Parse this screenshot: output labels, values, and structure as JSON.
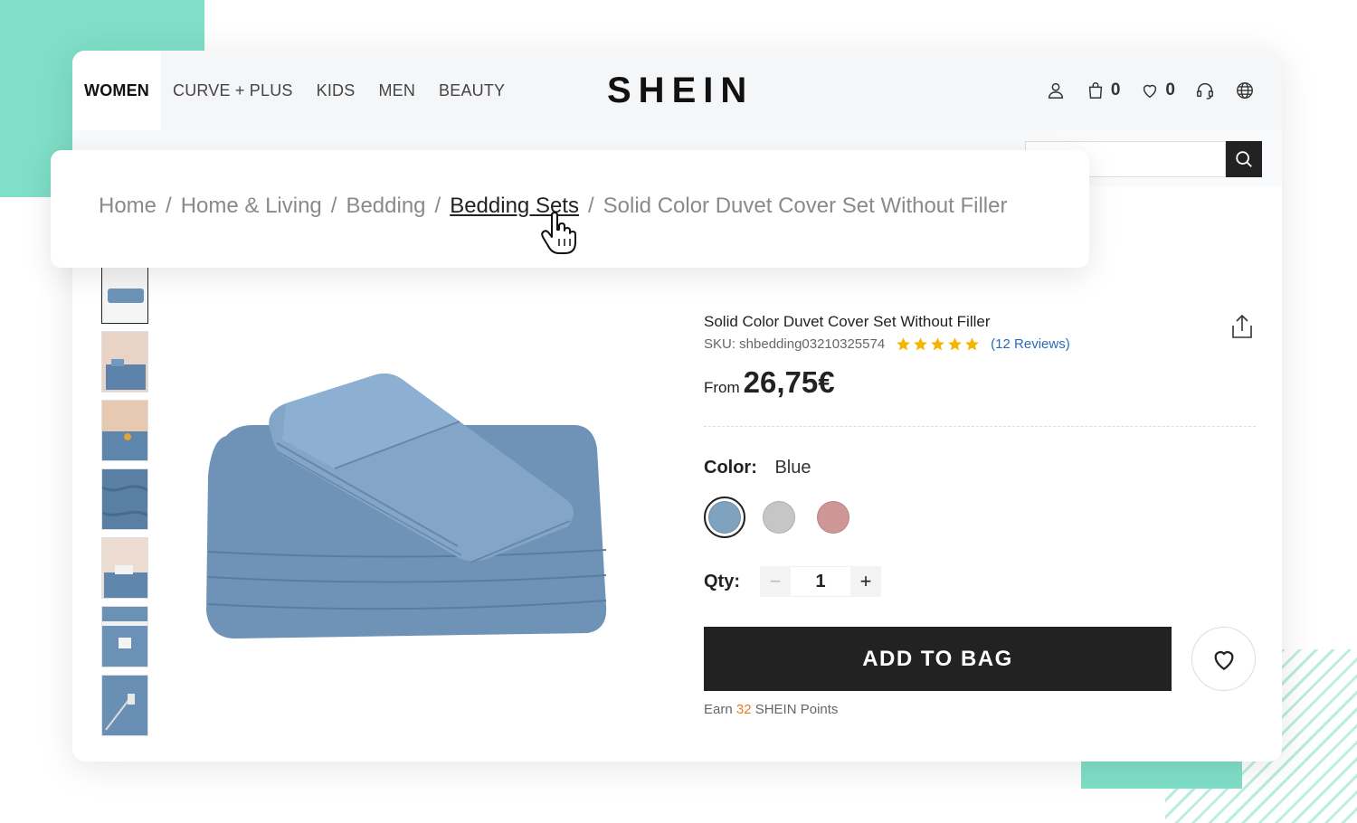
{
  "nav": {
    "items": [
      "WOMEN",
      "CURVE + PLUS",
      "KIDS",
      "MEN",
      "BEAUTY"
    ]
  },
  "logo": "SHEIN",
  "header": {
    "bag_count": "0",
    "wishlist_count": "0"
  },
  "search": {
    "value": "",
    "placeholder": ""
  },
  "breadcrumb": {
    "items": [
      "Home",
      "Home & Living",
      "Bedding",
      "Bedding Sets",
      "Solid Color Duvet Cover Set Without Filler"
    ],
    "separator": "/"
  },
  "product": {
    "title": "Solid Color Duvet Cover Set Without Filler",
    "sku": "SKU: shbedding03210325574",
    "rating": 5,
    "reviews": "(12 Reviews)",
    "price_prefix": "From",
    "price": "26,75€",
    "color_label": "Color:",
    "color_value": "Blue",
    "swatches": [
      {
        "name": "Blue",
        "hex": "#7fa2bf",
        "selected": true
      },
      {
        "name": "Gray",
        "hex": "#c6c6c6",
        "selected": false
      },
      {
        "name": "Pink",
        "hex": "#cf9696",
        "selected": false
      }
    ],
    "qty_label": "Qty:",
    "qty_value": "1",
    "qty_minus": "−",
    "qty_plus": "+",
    "add_to_bag": "ADD TO BAG",
    "points_prefix": "Earn",
    "points_value": "32",
    "points_suffix": "SHEIN Points"
  },
  "colors": {
    "accent": "#222222",
    "teal": "#7fdfc8",
    "link": "#2a6bb8",
    "star": "#f5b400",
    "points": "#ee7a1b"
  }
}
